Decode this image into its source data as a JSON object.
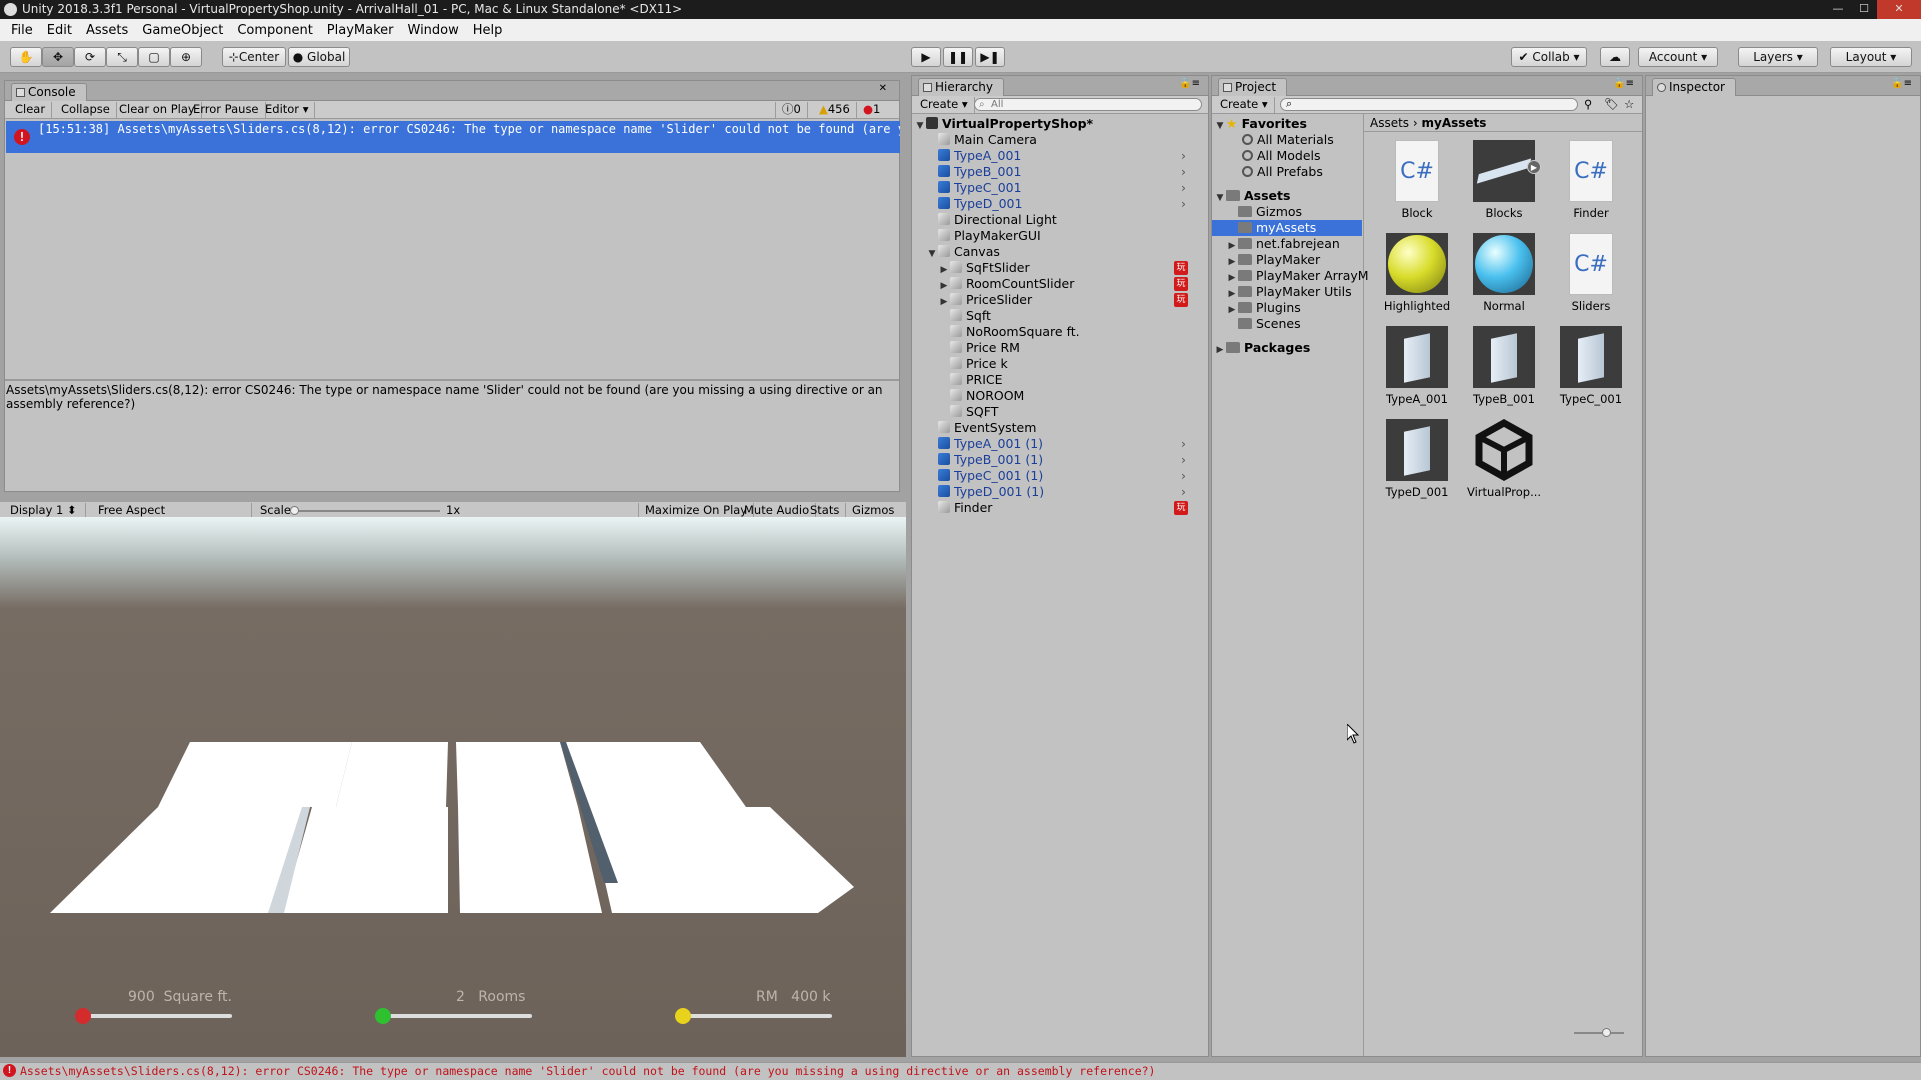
{
  "window": {
    "title": "Unity 2018.3.3f1 Personal - VirtualPropertyShop.unity - ArrivalHall_01 - PC, Mac & Linux Standalone* <DX11>",
    "controls": [
      "—",
      "☐",
      "✕"
    ]
  },
  "menu": [
    "File",
    "Edit",
    "Assets",
    "GameObject",
    "Component",
    "PlayMaker",
    "Window",
    "Help"
  ],
  "toolbar": {
    "pivot_label": "Center",
    "space_label": "Global",
    "collab_label": "Collab",
    "account_label": "Account",
    "layers_label": "Layers",
    "layout_label": "Layout"
  },
  "console": {
    "tab": "Console",
    "buttons": [
      "Clear",
      "Collapse",
      "Clear on Play",
      "Error Pause",
      "Editor"
    ],
    "counts": {
      "info": "0",
      "warnings": "456",
      "errors": "1"
    },
    "entry": "[15:51:38] Assets\\myAssets\\Sliders.cs(8,12): error CS0246: The type or namespace name 'Slider' could not be found (are you missing a using direc",
    "detail": "Assets\\myAssets\\Sliders.cs(8,12): error CS0246: The type or namespace name 'Slider' could not be found (are you missing a using directive or an assembly reference?)"
  },
  "game": {
    "display": "Display 1",
    "aspect": "Free Aspect",
    "scale_label": "Scale",
    "scale_value": "1x",
    "buttons": [
      "Maximize On Play",
      "Mute Audio",
      "Stats",
      "Gizmos"
    ],
    "sliders": [
      {
        "value": "900",
        "unit": "Square ft.",
        "color": "#d42c2c",
        "level": 0
      },
      {
        "value": "2",
        "unit": "Rooms",
        "color": "#2fc02f",
        "level": 0
      },
      {
        "value": "RM",
        "unit": "400 k",
        "color": "#e8d21c",
        "level": 0
      }
    ]
  },
  "hierarchy": {
    "tab": "Hierarchy",
    "create": "Create",
    "search_placeholder": "All",
    "scene": "VirtualPropertyShop*",
    "items": [
      {
        "label": "Main Camera",
        "kind": "gray",
        "depth": 0
      },
      {
        "label": "TypeA_001",
        "kind": "blue",
        "depth": 0,
        "arrow": true
      },
      {
        "label": "TypeB_001",
        "kind": "blue",
        "depth": 0,
        "arrow": true
      },
      {
        "label": "TypeC_001",
        "kind": "blue",
        "depth": 0,
        "arrow": true
      },
      {
        "label": "TypeD_001",
        "kind": "blue",
        "depth": 0,
        "arrow": true
      },
      {
        "label": "Directional Light",
        "kind": "gray",
        "depth": 0
      },
      {
        "label": "PlayMakerGUI",
        "kind": "gray",
        "depth": 0
      },
      {
        "label": "Canvas",
        "kind": "gray",
        "depth": 0,
        "expanded": true
      },
      {
        "label": "SqFtSlider",
        "kind": "gray",
        "depth": 1,
        "collapsed": true,
        "badge": true
      },
      {
        "label": "RoomCountSlider",
        "kind": "gray",
        "depth": 1,
        "collapsed": true,
        "badge": true
      },
      {
        "label": "PriceSlider",
        "kind": "gray",
        "depth": 1,
        "collapsed": true,
        "badge": true
      },
      {
        "label": "Sqft",
        "kind": "gray",
        "depth": 1
      },
      {
        "label": "NoRoomSquare ft.",
        "kind": "gray",
        "depth": 1
      },
      {
        "label": "Price RM",
        "kind": "gray",
        "depth": 1
      },
      {
        "label": "Price k",
        "kind": "gray",
        "depth": 1
      },
      {
        "label": "PRICE",
        "kind": "gray",
        "depth": 1
      },
      {
        "label": "NOROOM",
        "kind": "gray",
        "depth": 1
      },
      {
        "label": "SQFT",
        "kind": "gray",
        "depth": 1
      },
      {
        "label": "EventSystem",
        "kind": "gray",
        "depth": 0
      },
      {
        "label": "TypeA_001 (1)",
        "kind": "blue",
        "depth": 0,
        "arrow": true
      },
      {
        "label": "TypeB_001 (1)",
        "kind": "blue",
        "depth": 0,
        "arrow": true
      },
      {
        "label": "TypeC_001 (1)",
        "kind": "blue",
        "depth": 0,
        "arrow": true
      },
      {
        "label": "TypeD_001 (1)",
        "kind": "blue",
        "depth": 0,
        "arrow": true
      },
      {
        "label": "Finder",
        "kind": "gray",
        "depth": 0,
        "badge": true
      }
    ]
  },
  "project": {
    "tab": "Project",
    "create": "Create",
    "breadcrumb": [
      "Assets",
      "myAssets"
    ],
    "favorites_label": "Favorites",
    "favorites": [
      "All Materials",
      "All Models",
      "All Prefabs"
    ],
    "assets_label": "Assets",
    "folders": [
      {
        "label": "Gizmos",
        "expandable": false
      },
      {
        "label": "myAssets",
        "expandable": false,
        "selected": true
      },
      {
        "label": "net.fabrejean",
        "expandable": true
      },
      {
        "label": "PlayMaker",
        "expandable": true
      },
      {
        "label": "PlayMaker ArrayM",
        "expandable": true
      },
      {
        "label": "PlayMaker Utils",
        "expandable": true
      },
      {
        "label": "Plugins",
        "expandable": true
      },
      {
        "label": "Scenes",
        "expandable": false
      }
    ],
    "packages_label": "Packages",
    "assets": [
      {
        "label": "Block",
        "kind": "script"
      },
      {
        "label": "Blocks",
        "kind": "model"
      },
      {
        "label": "Finder",
        "kind": "script"
      },
      {
        "label": "Highlighted",
        "kind": "material-yellow"
      },
      {
        "label": "Normal",
        "kind": "material-blue"
      },
      {
        "label": "Sliders",
        "kind": "script"
      },
      {
        "label": "TypeA_001",
        "kind": "prefab"
      },
      {
        "label": "TypeB_001",
        "kind": "prefab"
      },
      {
        "label": "TypeC_001",
        "kind": "prefab"
      },
      {
        "label": "TypeD_001",
        "kind": "prefab"
      },
      {
        "label": "VirtualProp...",
        "kind": "scene"
      }
    ],
    "script_glyph": "C#"
  },
  "inspector": {
    "tab": "Inspector"
  },
  "status": {
    "message": "Assets\\myAssets\\Sliders.cs(8,12): error CS0246: The type or namespace name 'Slider' could not be found (are you missing a using directive or an assembly reference?)"
  }
}
